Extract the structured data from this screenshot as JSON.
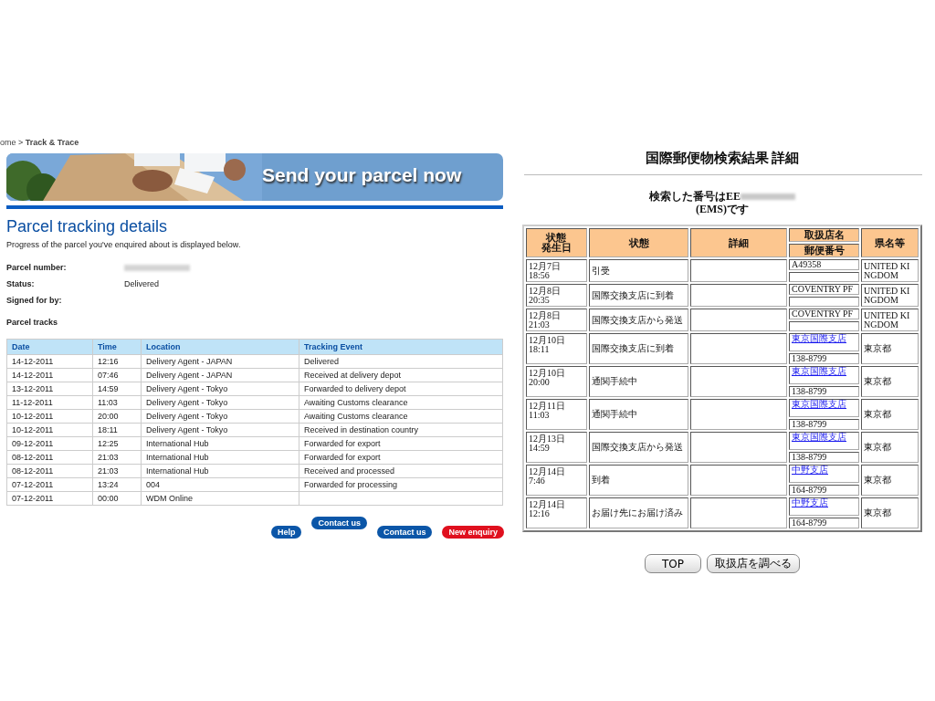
{
  "left_page": {
    "breadcrumb": "ome > **Track & Trace**",
    "banner": {
      "kind": "picture",
      "headline": "Send your parcel now"
    },
    "heading": "Parcel tracking details",
    "intro": "Progress of the parcel you've enquired about is displayed below.",
    "fields": [
      {
        "label": "Parcel number:",
        "redacted": true
      },
      {
        "label": "Status:",
        "value": "Delivered"
      },
      {
        "label": "Signed for by:"
      }
    ],
    "tracks_heading": "Parcel tracks",
    "table": {
      "columns": [
        "Date",
        "Time",
        "Location",
        "Tracking Event"
      ],
      "rows": [
        [
          "14-12-2011",
          "12:16",
          "Delivery Agent - JAPAN",
          "Delivered"
        ],
        [
          "14-12-2011",
          "07:46",
          "Delivery Agent - JAPAN",
          "Received at delivery depot"
        ],
        [
          "13-12-2011",
          "14:59",
          "Delivery Agent - Tokyo",
          "Forwarded to delivery depot"
        ],
        [
          "11-12-2011",
          "11:03",
          "Delivery Agent - Tokyo",
          "Awaiting Customs clearance"
        ],
        [
          "10-12-2011",
          "20:00",
          "Delivery Agent - Tokyo",
          "Awaiting Customs clearance"
        ],
        [
          "10-12-2011",
          "18:11",
          "Delivery Agent - Tokyo",
          "Received in destination country"
        ],
        [
          "09-12-2011",
          "12:25",
          "International Hub",
          "Forwarded for export"
        ],
        [
          "08-12-2011",
          "21:03",
          "International Hub",
          "Forwarded for export"
        ],
        [
          "08-12-2011",
          "21:03",
          "International Hub",
          "Received and processed"
        ],
        [
          "07-12-2011",
          "13:24",
          "004",
          "Forwarded for processing"
        ],
        [
          "07-12-2011",
          "00:00",
          "WDM Online",
          ""
        ]
      ]
    },
    "buttons": [
      {
        "label": "Help",
        "kind": "primary"
      },
      {
        "label": "Contact us",
        "kind": "primary"
      },
      {
        "label": "Contact us",
        "kind": "primary"
      },
      {
        "label": "New enquiry",
        "kind": "alert"
      }
    ]
  },
  "right_page": {
    "title": "国際郵便物検索結果 詳細",
    "query_prefix": "検索した番号はEE",
    "query_redacted": true,
    "query_suffix": "(EMS)です",
    "table": {
      "first_column": [
        "状態",
        "発生日"
      ],
      "columns": [
        "状態",
        "詳細",
        "取扱店名",
        "郵便番号",
        "県名等"
      ],
      "rows": [
        {
          "when": "12月7日\n18:56",
          "status": "引受",
          "office": {
            "text": "A49358",
            "kind": "text"
          },
          "region": "UNITED KINGDOM"
        },
        {
          "when": "12月8日\n20:35",
          "status": "国際交換支店に到着",
          "office": {
            "text": "COVENTRY PF",
            "kind": "text"
          },
          "region": "UNITED KINGDOM"
        },
        {
          "when": "12月8日\n21:03",
          "status": "国際交換支店から発送",
          "office": {
            "text": "COVENTRY PF",
            "kind": "text"
          },
          "region": "UNITED KINGDOM"
        },
        {
          "when": "12月10日\n18:11",
          "status": "国際交換支店に到着",
          "office": {
            "text": "東京国際支店",
            "kind": "link"
          },
          "postcode": "138-8799",
          "region": "東京都"
        },
        {
          "when": "12月10日\n20:00",
          "status": "通関手続中",
          "office": {
            "text": "東京国際支店",
            "kind": "link"
          },
          "postcode": "138-8799",
          "region": "東京都"
        },
        {
          "when": "12月11日\n11:03",
          "status": "通関手続中",
          "office": {
            "text": "東京国際支店",
            "kind": "link"
          },
          "postcode": "138-8799",
          "region": "東京都"
        },
        {
          "when": "12月13日\n14:59",
          "status": "国際交換支店から発送",
          "office": {
            "text": "東京国際支店",
            "kind": "link"
          },
          "postcode": "138-8799",
          "region": "東京都"
        },
        {
          "when": "12月14日\n7:46",
          "status": "到着",
          "office": {
            "text": "中野支店",
            "kind": "link"
          },
          "postcode": "164-8799",
          "region": "東京都"
        },
        {
          "when": "12月14日\n12:16",
          "status": "お届け先にお届け済み",
          "office": {
            "text": "中野支店",
            "kind": "link"
          },
          "postcode": "164-8799",
          "region": "東京都"
        }
      ]
    },
    "buttons": [
      "TOP",
      "取扱店を調べる"
    ]
  }
}
